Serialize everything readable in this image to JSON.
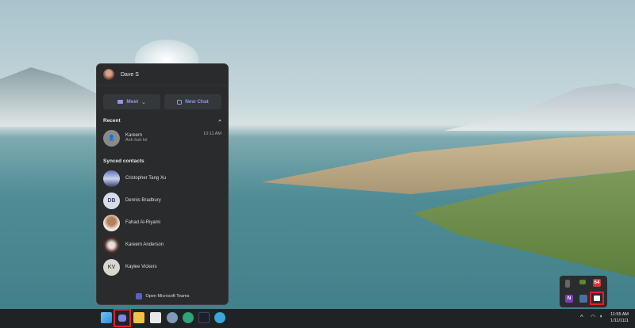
{
  "flyout": {
    "user_name": "Dave S",
    "meet_label": "Meet",
    "new_chat_label": "New Chat",
    "recent_heading": "Recent",
    "recent": [
      {
        "name": "Kareem",
        "preview": "Anh huh lol",
        "time": "10:11 AM"
      }
    ],
    "synced_heading": "Synced contacts",
    "contacts": [
      {
        "name": "Cristopher Tang Xu",
        "initials": ""
      },
      {
        "name": "Dennis Bradbury",
        "initials": "DB"
      },
      {
        "name": "Fahad Al-Riyami",
        "initials": ""
      },
      {
        "name": "Kareem Anderson",
        "initials": ""
      },
      {
        "name": "Kaylee Vickers",
        "initials": "KV"
      }
    ],
    "open_teams_label": "Open Microsoft Teams"
  },
  "accent": "#8f95e8",
  "highlight": "#e0202a",
  "tray": {
    "badge_64": "64",
    "onenote": "N"
  },
  "clock": {
    "time": "11:55 AM",
    "date": "1/11/1111"
  },
  "taskbar_icons": [
    "windows-start",
    "teams-chat",
    "file-explorer",
    "microsoft-store",
    "settings",
    "edge-beta",
    "terminal",
    "edge"
  ]
}
